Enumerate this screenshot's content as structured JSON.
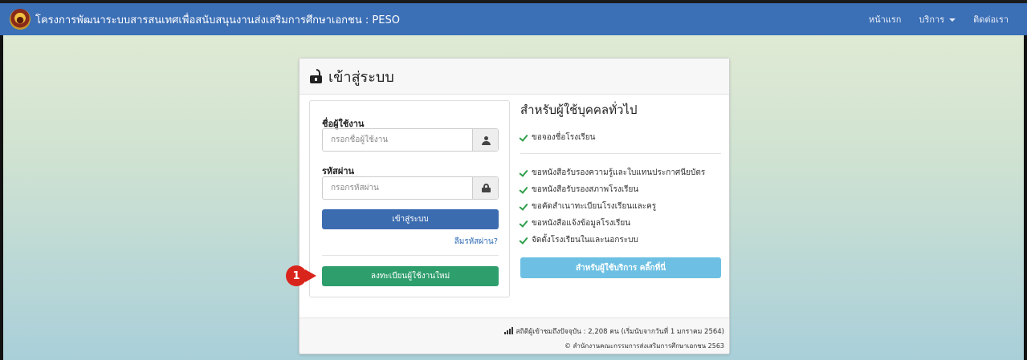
{
  "navbar": {
    "brand": "โครงการพัฒนาระบบสารสนเทศเพื่อสนับสนุนงานส่งเสริมการศึกษาเอกชน : PESO",
    "links": {
      "home": "หน้าแรก",
      "services": "บริการ",
      "contact": "ติดต่อเรา"
    },
    "color": "#3b6fb6"
  },
  "card": {
    "title": "เข้าสู่ระบบ",
    "icon": "unlock-icon"
  },
  "login": {
    "username_label": "ชื่อผู้ใช้งาน",
    "username_placeholder": "กรอกชื่อผู้ใช้งาน",
    "password_label": "รหัสผ่าน",
    "password_placeholder": "กรอกรหัสผ่าน",
    "login_button": "เข้าสู่ระบบ",
    "forgot_link": "ลืมรหัสผ่าน?",
    "register_button": "ลงทะเบียนผู้ใช้งานใหม่"
  },
  "annotation": {
    "step_number": "1"
  },
  "general": {
    "title": "สำหรับผู้ใช้บุคคลทั่วไป",
    "items_top": [
      "ขอจองชื่อโรงเรียน"
    ],
    "items": [
      "ขอหนังสือรับรองความรู้และใบแทนประกาศนียบัตร",
      "ขอหนังสือรับรองสภาพโรงเรียน",
      "ขอคัดสำเนาทะเบียนโรงเรียนและครู",
      "ขอหนังสือแจ้งข้อมูลโรงเรียน",
      "จัดตั้งโรงเรียนในและนอกระบบ"
    ],
    "service_button": "สำหรับผู้ใช้บริการ คลิ๊กที่นี่"
  },
  "footer": {
    "stats": "สถิติผู้เข้าชมถึงปัจจุบัน : 2,208 คน (เริ่มนับจากวันที่ 1 มกราคม 2564)",
    "copyright": "© สำนักงานคณะกรรมการส่งเสริมการศึกษาเอกชน 2563"
  }
}
